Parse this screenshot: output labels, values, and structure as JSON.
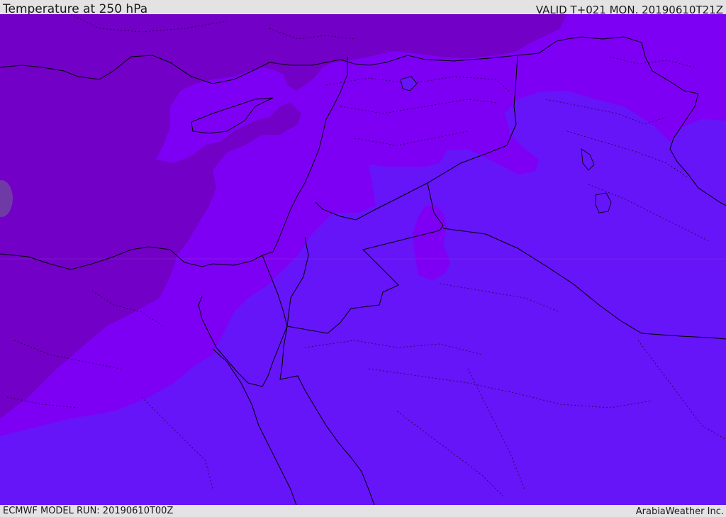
{
  "header": {
    "title": "Temperature at 250 hPa",
    "valid": "VALID T+021 MON. 20190610T21Z"
  },
  "footer": {
    "model_run": "ECMWF MODEL RUN: 20190610T00Z",
    "credit": "ArabiaWeather Inc."
  },
  "map": {
    "field": "temperature",
    "level": "250 hPa",
    "colors": {
      "coldest_band": "#7200c6",
      "cold_band": "#7e00f4",
      "mid_band": "#6614f8",
      "warm_spot": "#6f3aa6",
      "border_line": "#000000"
    }
  }
}
